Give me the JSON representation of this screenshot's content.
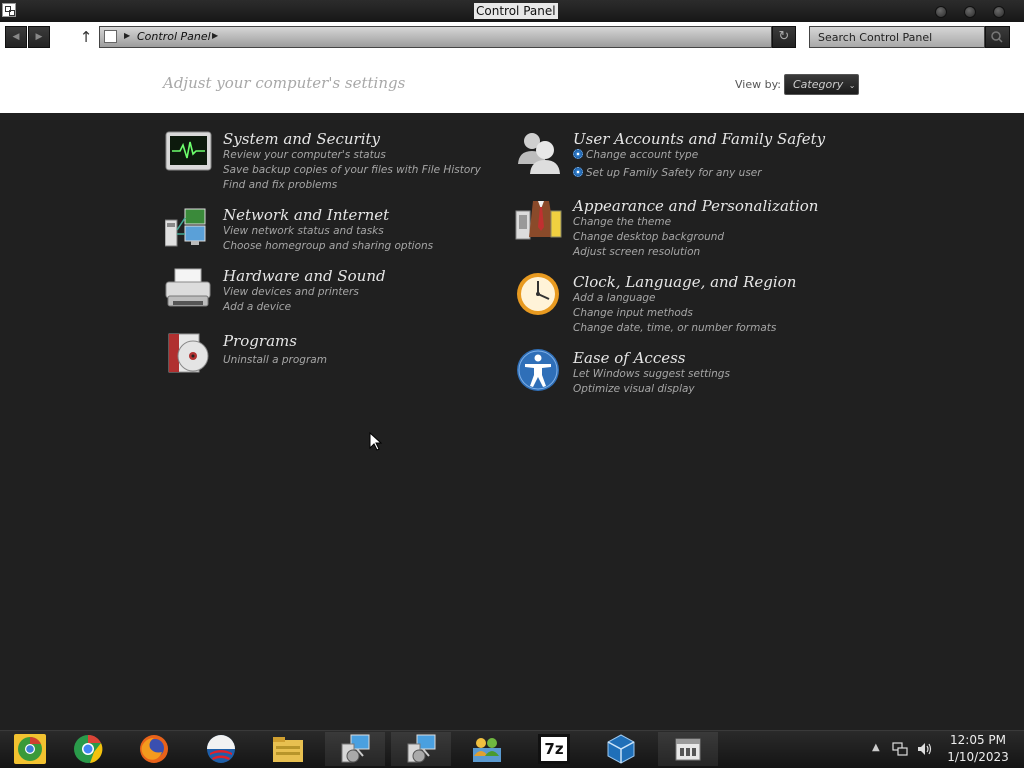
{
  "window": {
    "title": "Control Panel"
  },
  "navigation": {
    "back_label": "◀",
    "forward_label": "▶",
    "up_label": "↑",
    "address_path": "Control Panel",
    "refresh_label": "↻",
    "search_placeholder": "Search Control Panel"
  },
  "header": {
    "heading": "Adjust your computer's settings",
    "view_by_label": "View by:",
    "view_by_value": "Category",
    "view_by_chevron": "⌄"
  },
  "categories": [
    {
      "title": "System and Security",
      "icon": "system-security-monitor-icon",
      "links": [
        "Review your computer's status",
        "Save backup copies of your files with File History",
        "Find and fix problems"
      ]
    },
    {
      "title": "Network and Internet",
      "icon": "network-computers-icon",
      "links": [
        "View network status and tasks",
        "Choose homegroup and sharing options"
      ]
    },
    {
      "title": "Hardware and Sound",
      "icon": "printer-icon",
      "links": [
        "View devices and printers",
        "Add a device"
      ]
    },
    {
      "title": "Programs",
      "icon": "programs-disc-icon",
      "links": [
        "Uninstall a program"
      ]
    },
    {
      "title": "User Accounts and Family Safety",
      "icon": "users-icon",
      "links": [
        "Change account type",
        "Set up Family Safety for any user"
      ]
    },
    {
      "title": "Appearance and Personalization",
      "icon": "appearance-suit-icon",
      "links": [
        "Change the theme",
        "Change desktop background",
        "Adjust screen resolution"
      ]
    },
    {
      "title": "Clock, Language, and Region",
      "icon": "clock-icon",
      "links": [
        "Add a language",
        "Change input methods",
        "Change date, time, or number formats"
      ]
    },
    {
      "title": "Ease of Access",
      "icon": "ease-of-access-icon",
      "links": [
        "Let Windows suggest settings",
        "Optimize visual display"
      ]
    }
  ],
  "taskbar": {
    "apps": [
      "chrome-canary-icon",
      "chrome-icon",
      "firefox-icon",
      "obama-logo-icon",
      "file-explorer-icon",
      "network-setup-icon",
      "network-setup-2-icon",
      "users-network-icon",
      "7zip-icon",
      "virtualbox-icon",
      "control-panel-icon"
    ],
    "app_7zip_label": "7z",
    "tray_arrow": "▲",
    "time": "12:05 PM",
    "date": "1/10/2023"
  },
  "colors": {
    "accent_blue": "#2f6fb8",
    "background": "#202020",
    "link_text": "#a6a6a6"
  }
}
